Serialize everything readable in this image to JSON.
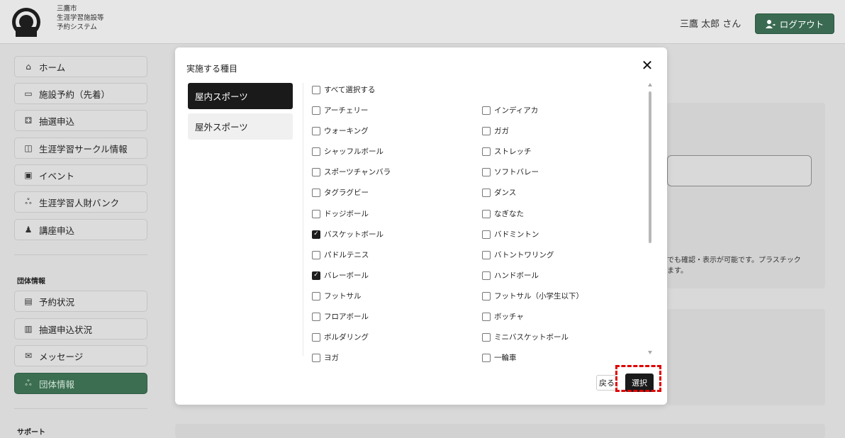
{
  "header": {
    "brand_lines": [
      "三鷹市",
      "生涯学習施設等",
      "予約システム"
    ],
    "user_name": "三鷹 太郎 さん",
    "logout_label": "ログアウト"
  },
  "sidebar": {
    "items": [
      {
        "label": "ホーム",
        "icon": "home-icon"
      },
      {
        "label": "施設予約（先着）",
        "icon": "calendar-icon"
      },
      {
        "label": "抽選申込",
        "icon": "dice-icon"
      },
      {
        "label": "生涯学習サークル情報",
        "icon": "circle-info-icon"
      },
      {
        "label": "イベント",
        "icon": "event-calendar-icon"
      },
      {
        "label": "生涯学習人財バンク",
        "icon": "people-icon"
      },
      {
        "label": "講座申込",
        "icon": "lecture-icon"
      }
    ],
    "group_label": "団体情報",
    "group_items": [
      {
        "label": "予約状況",
        "icon": "reservation-icon"
      },
      {
        "label": "抽選申込状況",
        "icon": "lottery-status-icon"
      },
      {
        "label": "メッセージ",
        "icon": "mail-icon"
      },
      {
        "label": "団体情報",
        "icon": "group-icon",
        "active": true
      }
    ],
    "support_label": "サポート"
  },
  "background": {
    "notice_line1": "でも確認・表示が可能です。プラスチック",
    "notice_line2": "ます。"
  },
  "modal": {
    "title": "実施する種目",
    "tabs": [
      "屋内スポーツ",
      "屋外スポーツ"
    ],
    "select_all": "すべて選択する",
    "items_left": [
      {
        "label": "アーチェリー",
        "checked": false
      },
      {
        "label": "ウォーキング",
        "checked": false
      },
      {
        "label": "シャッフルボール",
        "checked": false
      },
      {
        "label": "スポーツチャンバラ",
        "checked": false
      },
      {
        "label": "タグラグビー",
        "checked": false
      },
      {
        "label": "ドッジボール",
        "checked": false
      },
      {
        "label": "バスケットボール",
        "checked": true
      },
      {
        "label": "パドルテニス",
        "checked": false
      },
      {
        "label": "バレーボール",
        "checked": true
      },
      {
        "label": "フットサル",
        "checked": false
      },
      {
        "label": "フロアボール",
        "checked": false
      },
      {
        "label": "ボルダリング",
        "checked": false
      },
      {
        "label": "ヨガ",
        "checked": false
      }
    ],
    "items_right": [
      {
        "label": "インディアカ",
        "checked": false
      },
      {
        "label": "ガガ",
        "checked": false
      },
      {
        "label": "ストレッチ",
        "checked": false
      },
      {
        "label": "ソフトバレー",
        "checked": false
      },
      {
        "label": "ダンス",
        "checked": false
      },
      {
        "label": "なぎなた",
        "checked": false
      },
      {
        "label": "バドミントン",
        "checked": false
      },
      {
        "label": "バトントワリング",
        "checked": false
      },
      {
        "label": "ハンドボール",
        "checked": false
      },
      {
        "label": "フットサル（小学生以下）",
        "checked": false
      },
      {
        "label": "ボッチャ",
        "checked": false
      },
      {
        "label": "ミニバスケットボール",
        "checked": false
      },
      {
        "label": "一輪車",
        "checked": false
      }
    ],
    "back_label": "戻る",
    "select_label": "選択"
  },
  "colors": {
    "accent_green": "#3c6e51",
    "highlight_red": "#e00000",
    "modal_primary": "#1a1a1a"
  }
}
